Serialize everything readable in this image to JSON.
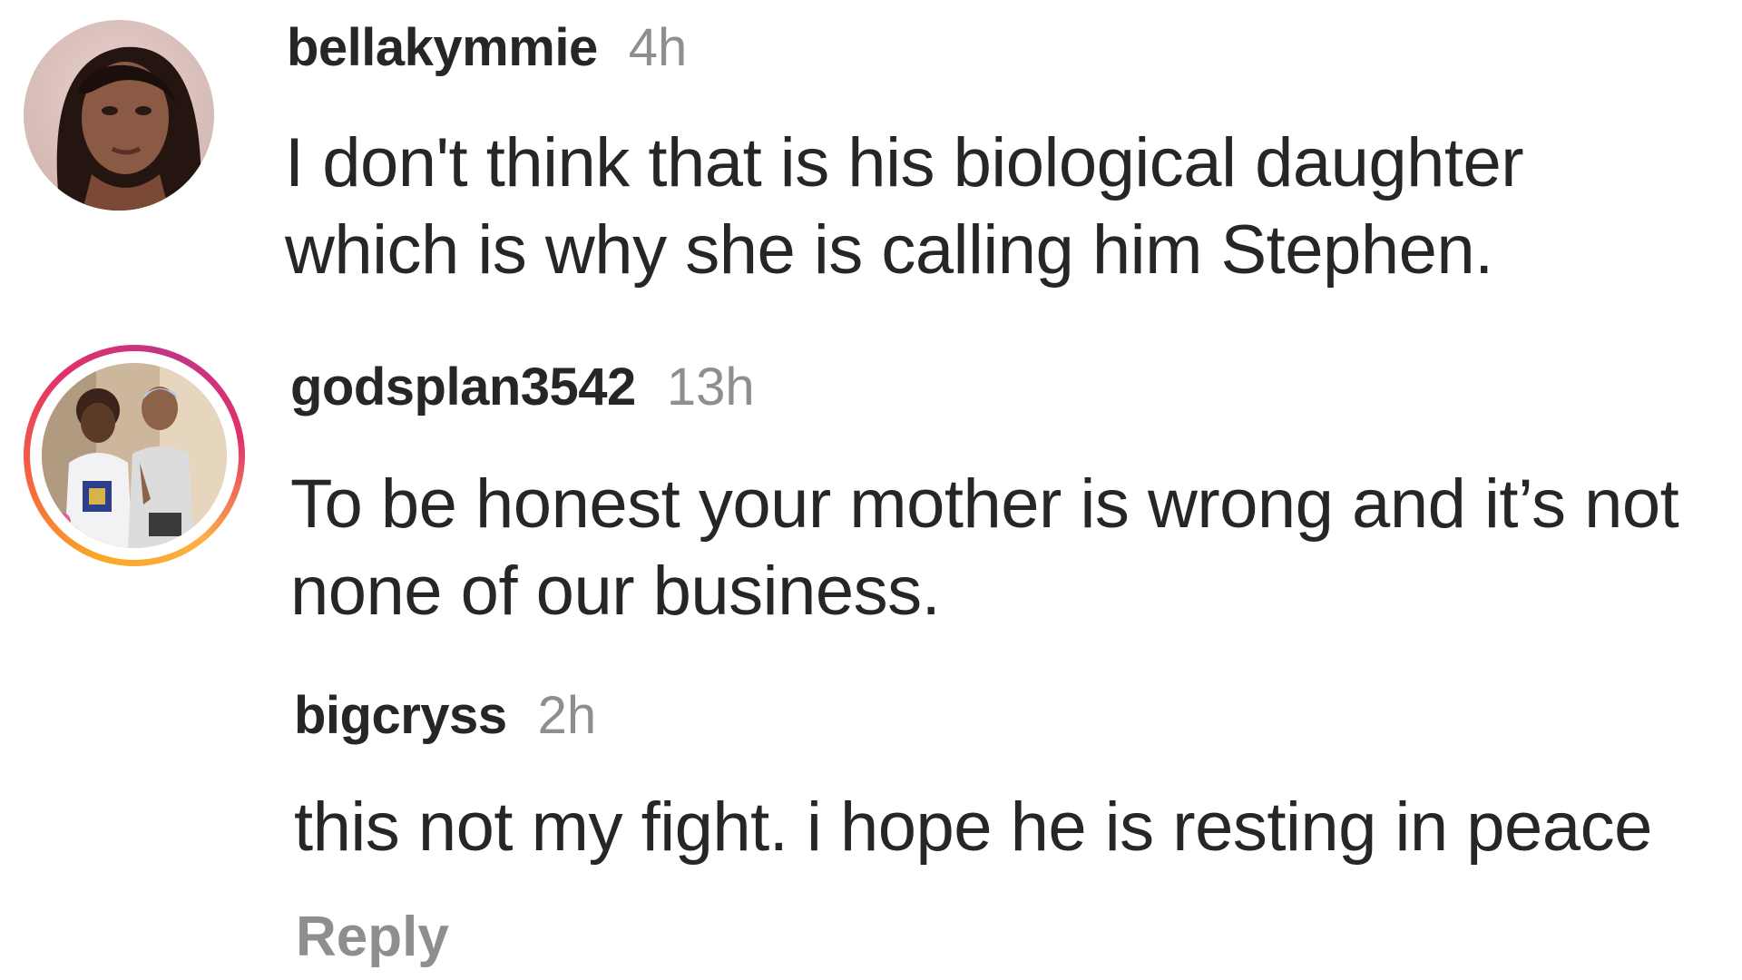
{
  "comments": [
    {
      "username": "bellakymmie",
      "time": "4h",
      "lines": [
        "I don't think that is his biological daughter",
        "which is why she is calling him Stephen."
      ],
      "avatar_icon": "profile-photo-woman",
      "has_story_ring": false
    },
    {
      "username": "godsplan3542",
      "time": "13h",
      "lines": [
        "To be honest your mother is wrong and it’s not",
        "none of our business."
      ],
      "avatar_icon": "profile-photo-couple",
      "has_story_ring": true
    }
  ],
  "reply": {
    "username": "bigcryss",
    "time": "2h",
    "text": "this not my fight. i hope he is resting in peace",
    "action_label": "Reply"
  },
  "colors": {
    "text_primary": "#262626",
    "text_secondary": "#8e8e8e",
    "story_ring_start": "#fcaf45",
    "story_ring_end": "#c13584"
  }
}
